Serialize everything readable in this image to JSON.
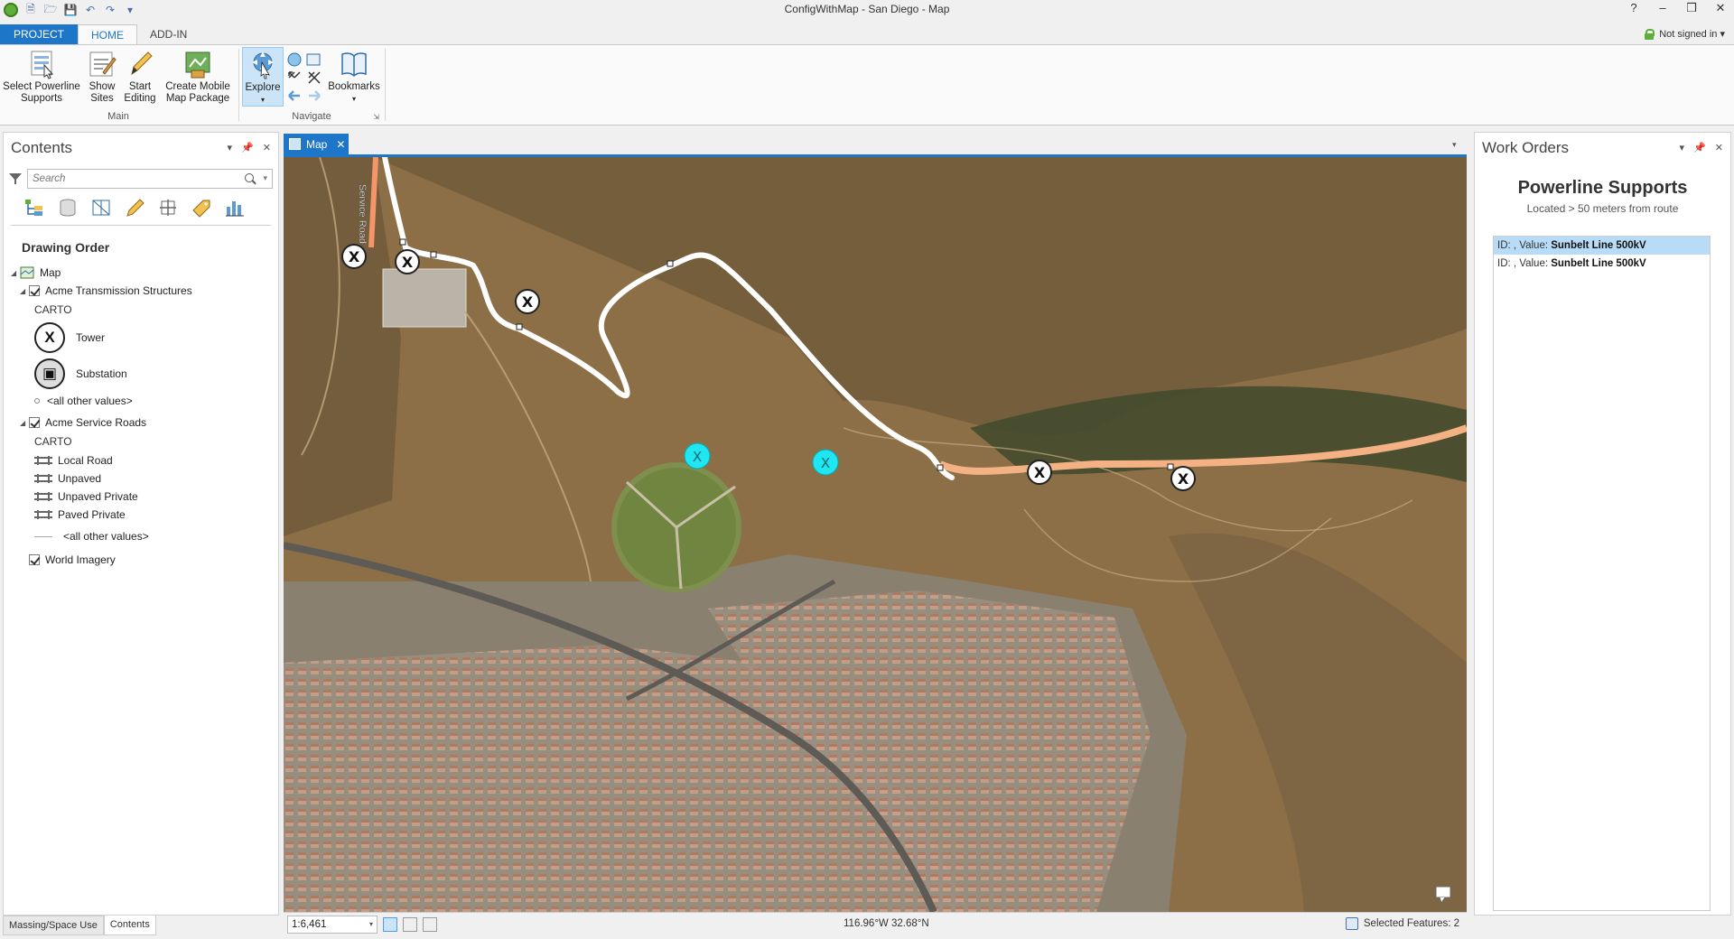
{
  "window": {
    "title": "ConfigWithMap - San Diego - Map",
    "controls": [
      "?",
      "–",
      "❒",
      "✕"
    ]
  },
  "ribbon": {
    "tabs": [
      "PROJECT",
      "HOME",
      "ADD-IN"
    ],
    "active_tab": "HOME",
    "signin": "Not signed in ▾",
    "groups": {
      "main": {
        "label": "Main",
        "buttons": [
          "Select Powerline\nSupports",
          "Show\nSites",
          "Start\nEditing",
          "Create Mobile\nMap Package"
        ]
      },
      "navigate": {
        "label": "Navigate",
        "explore": "Explore",
        "bookmarks": "Bookmarks"
      }
    }
  },
  "contents": {
    "title": "Contents",
    "search_placeholder": "Search",
    "drawing_order": "Drawing Order",
    "map_label": "Map",
    "layers": [
      {
        "name": "Acme Transmission Structures",
        "checked": true,
        "heading": "CARTO",
        "symbols": [
          "Tower",
          "Substation"
        ],
        "other": "<all other values>"
      },
      {
        "name": "Acme Service Roads",
        "checked": true,
        "heading": "CARTO",
        "symbols": [
          "Local Road",
          "Unpaved",
          "Unpaved Private",
          "Paved Private"
        ],
        "other": "<all other values>"
      },
      {
        "name": "World Imagery",
        "checked": true
      }
    ],
    "bottom_tabs": [
      "Massing/Space Use",
      "Contents"
    ]
  },
  "map": {
    "tab_label": "Map",
    "road_label": "Service Road",
    "scale": "1:6,461",
    "coordinates": "116.96°W 32.68°N",
    "selected_features": "Selected Features: 2",
    "colors": {
      "route": "#ffffff",
      "road_orange": "#f4b183",
      "selected_tower": "#00e5ee"
    }
  },
  "work_orders": {
    "panel_title": "Work Orders",
    "heading": "Powerline Supports",
    "subheading": "Located > 50 meters from route",
    "items": [
      {
        "prefix": "ID: , Value: ",
        "value": "Sunbelt Line 500kV",
        "selected": true
      },
      {
        "prefix": "ID: , Value: ",
        "value": "Sunbelt Line 500kV",
        "selected": false
      }
    ]
  }
}
